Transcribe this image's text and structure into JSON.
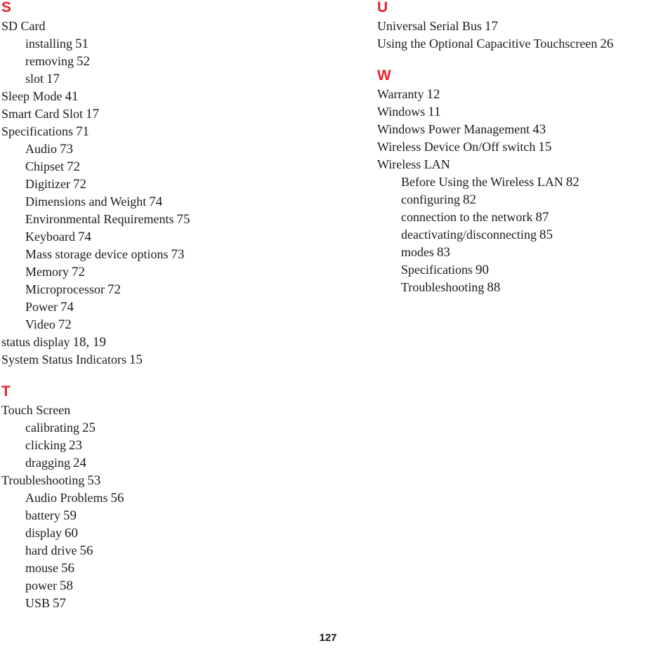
{
  "document": {
    "type": "index",
    "folio": "127",
    "heading_color": "#e4222c",
    "text_color": "#1a1a1a"
  },
  "columns": [
    {
      "id": "left",
      "sections": [
        {
          "letter": "S",
          "entries": [
            {
              "level": 1,
              "label": "SD Card",
              "pages": ""
            },
            {
              "level": 2,
              "label": "installing",
              "pages": "51"
            },
            {
              "level": 2,
              "label": "removing",
              "pages": "52"
            },
            {
              "level": 2,
              "label": "slot",
              "pages": "17"
            },
            {
              "level": 1,
              "label": "Sleep Mode",
              "pages": "41"
            },
            {
              "level": 1,
              "label": "Smart Card Slot",
              "pages": "17"
            },
            {
              "level": 1,
              "label": "Specifications",
              "pages": "71"
            },
            {
              "level": 2,
              "label": "Audio",
              "pages": "73"
            },
            {
              "level": 2,
              "label": "Chipset",
              "pages": "72"
            },
            {
              "level": 2,
              "label": "Digitizer",
              "pages": "72"
            },
            {
              "level": 2,
              "label": "Dimensions and Weight",
              "pages": "74"
            },
            {
              "level": 2,
              "label": "Environmental Requirements",
              "pages": "75"
            },
            {
              "level": 2,
              "label": "Keyboard",
              "pages": "74"
            },
            {
              "level": 2,
              "label": "Mass storage device options",
              "pages": "73"
            },
            {
              "level": 2,
              "label": "Memory",
              "pages": "72"
            },
            {
              "level": 2,
              "label": "Microprocessor",
              "pages": "72"
            },
            {
              "level": 2,
              "label": "Power",
              "pages": "74"
            },
            {
              "level": 2,
              "label": "Video",
              "pages": "72"
            },
            {
              "level": 1,
              "label": "status display",
              "pages": "18, 19"
            },
            {
              "level": 1,
              "label": "System Status Indicators",
              "pages": "15"
            }
          ]
        },
        {
          "letter": "T",
          "entries": [
            {
              "level": 1,
              "label": "Touch Screen",
              "pages": ""
            },
            {
              "level": 2,
              "label": "calibrating",
              "pages": "25"
            },
            {
              "level": 2,
              "label": "clicking",
              "pages": "23"
            },
            {
              "level": 2,
              "label": "dragging",
              "pages": "24"
            },
            {
              "level": 1,
              "label": "Troubleshooting",
              "pages": "53"
            },
            {
              "level": 2,
              "label": "Audio Problems",
              "pages": "56"
            },
            {
              "level": 2,
              "label": "battery",
              "pages": "59"
            },
            {
              "level": 2,
              "label": "display",
              "pages": "60"
            },
            {
              "level": 2,
              "label": "hard drive",
              "pages": "56"
            },
            {
              "level": 2,
              "label": "mouse",
              "pages": "56"
            },
            {
              "level": 2,
              "label": "power",
              "pages": "58"
            },
            {
              "level": 2,
              "label": "USB",
              "pages": "57"
            }
          ]
        }
      ]
    },
    {
      "id": "right",
      "sections": [
        {
          "letter": "U",
          "entries": [
            {
              "level": 1,
              "label": "Universal Serial Bus",
              "pages": "17"
            },
            {
              "level": 1,
              "label": "Using the Optional Capacitive Touchscreen",
              "pages": "26"
            }
          ]
        },
        {
          "letter": "W",
          "entries": [
            {
              "level": 1,
              "label": "Warranty",
              "pages": "12"
            },
            {
              "level": 1,
              "label": "Windows",
              "pages": "11"
            },
            {
              "level": 1,
              "label": "Windows Power Management",
              "pages": "43"
            },
            {
              "level": 1,
              "label": "Wireless Device On/Off switch",
              "pages": "15"
            },
            {
              "level": 1,
              "label": "Wireless LAN",
              "pages": ""
            },
            {
              "level": 2,
              "label": "Before Using the Wireless LAN",
              "pages": "82"
            },
            {
              "level": 2,
              "label": "configuring",
              "pages": "82"
            },
            {
              "level": 2,
              "label": "connection to the network",
              "pages": "87"
            },
            {
              "level": 2,
              "label": "deactivating/disconnecting",
              "pages": "85"
            },
            {
              "level": 2,
              "label": "modes",
              "pages": "83"
            },
            {
              "level": 2,
              "label": "Specifications",
              "pages": "90"
            },
            {
              "level": 2,
              "label": "Troubleshooting",
              "pages": "88"
            }
          ]
        }
      ]
    }
  ]
}
